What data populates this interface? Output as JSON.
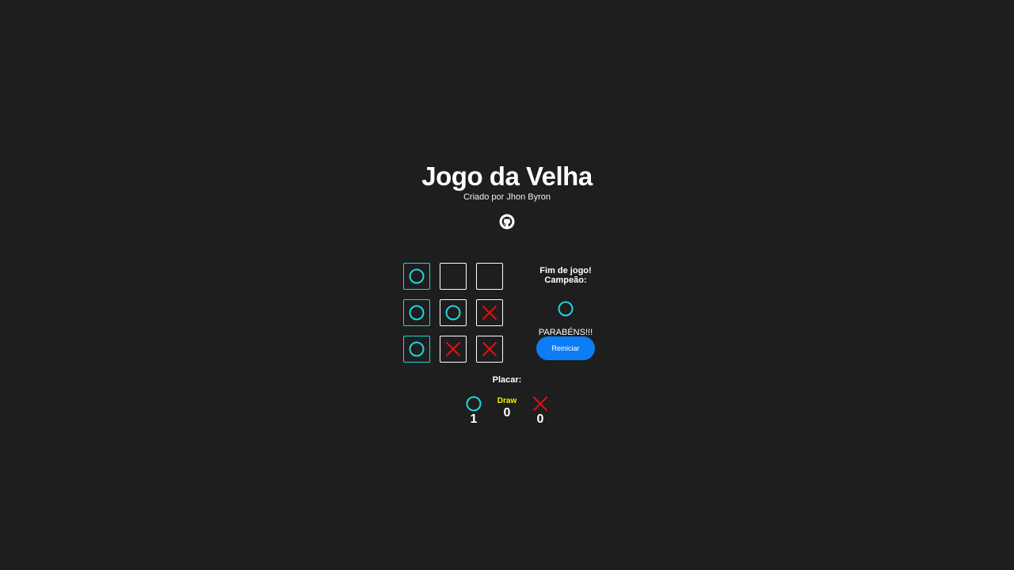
{
  "header": {
    "title": "Jogo da Velha",
    "subtitle": "Criado por Jhon Byron",
    "github_icon": "github-icon"
  },
  "board": {
    "cells": [
      {
        "mark": "O",
        "winning": true
      },
      {
        "mark": "",
        "winning": false
      },
      {
        "mark": "",
        "winning": false
      },
      {
        "mark": "O",
        "winning": true
      },
      {
        "mark": "O",
        "winning": false
      },
      {
        "mark": "X",
        "winning": false
      },
      {
        "mark": "O",
        "winning": true
      },
      {
        "mark": "X",
        "winning": false
      },
      {
        "mark": "X",
        "winning": false
      }
    ]
  },
  "result": {
    "title": "Fim de jogo! Campeão:",
    "winner": "O",
    "message": "PARABÉNS!!!",
    "restart_label": "Reiniciar"
  },
  "score": {
    "label": "Placar:",
    "o_wins": "1",
    "draw_label": "Draw",
    "draws": "0",
    "x_wins": "0"
  },
  "colors": {
    "background": "#1e1e1e",
    "o_color": "#1fd6e0",
    "x_color": "#e01010",
    "draw_color": "#f4f400",
    "button": "#0d7df5"
  }
}
